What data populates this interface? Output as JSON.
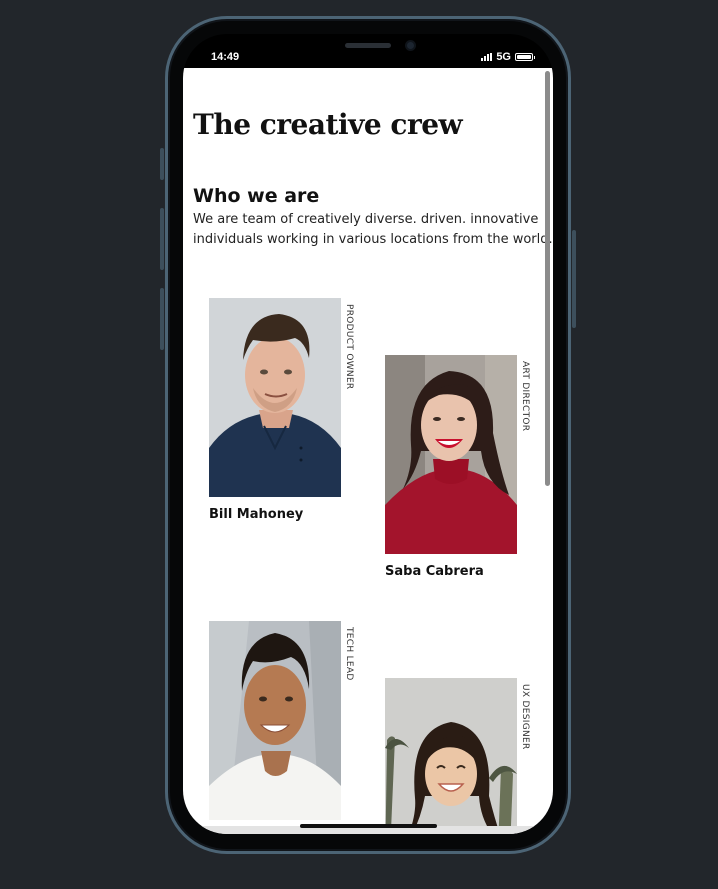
{
  "status_bar": {
    "time": "14:49",
    "network": "5G"
  },
  "page": {
    "title": "The creative crew",
    "section_heading": "Who we are",
    "intro": "We are team of creatively diverse. driven. innovative individuals working in various locations from the world."
  },
  "team": [
    {
      "name": "Bill Mahoney",
      "role": "PRODUCT OWNER"
    },
    {
      "name": "Saba Cabrera",
      "role": "ART DIRECTOR"
    },
    {
      "name": "",
      "role": "TECH LEAD"
    },
    {
      "name": "",
      "role": "UX DESIGNER"
    }
  ],
  "icons": [
    "signal-icon",
    "battery-icon",
    "camera-icon"
  ],
  "colors": {
    "background": "#22262b",
    "frame": "#4c6475",
    "screen": "#ffffff",
    "text": "#111111"
  }
}
